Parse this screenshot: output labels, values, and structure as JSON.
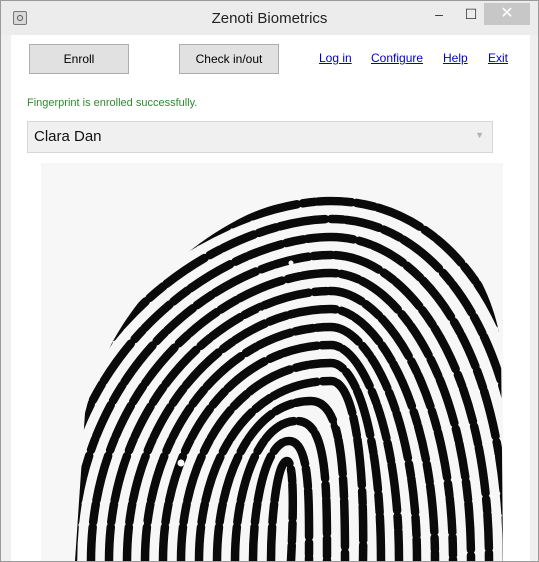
{
  "window": {
    "title": "Zenoti Biometrics"
  },
  "titlebar": {
    "minimize": "–",
    "maximize": "☐",
    "close": "✕"
  },
  "toolbar": {
    "enroll_label": "Enroll",
    "checkin_label": "Check in/out",
    "links": {
      "login": "Log in",
      "configure": "Configure",
      "help": "Help",
      "exit": "Exit"
    }
  },
  "status": {
    "message": "Fingerprint is enrolled successfully.",
    "color": "#2e8b2e"
  },
  "employee_select": {
    "selected": "Clara Dan"
  },
  "icons": {
    "app": "app-icon",
    "dropdown": "chevron-down-icon",
    "fingerprint": "fingerprint-image"
  }
}
